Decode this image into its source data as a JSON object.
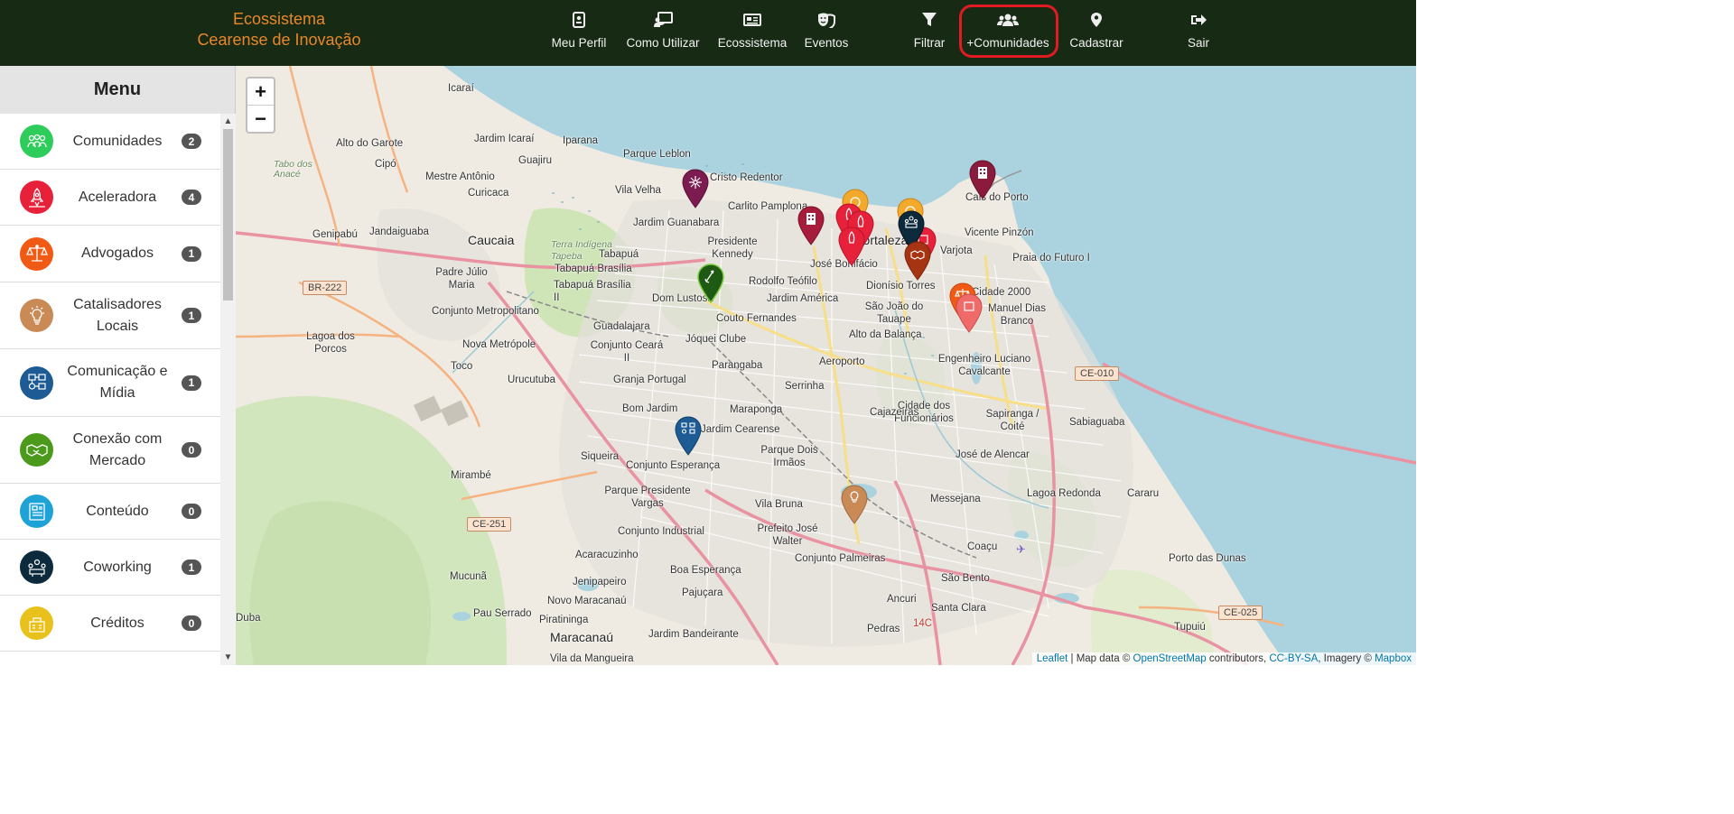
{
  "header": {
    "brand_line1": "Ecossistema",
    "brand_line2": "Cearense de Inovação",
    "nav": [
      {
        "label": "Meu Perfil",
        "icon": "id-badge-icon"
      },
      {
        "label": "Como Utilizar",
        "icon": "chalkboard-teacher-icon"
      },
      {
        "label": "Ecossistema",
        "icon": "newspaper-icon"
      },
      {
        "label": "Eventos",
        "icon": "masks-theater-icon"
      },
      {
        "label": "Filtrar",
        "icon": "filter-icon"
      },
      {
        "label": "+Comunidades",
        "icon": "users-icon"
      },
      {
        "label": "Cadastrar",
        "icon": "map-marker-icon"
      },
      {
        "label": "Sair",
        "icon": "sign-out-icon"
      }
    ]
  },
  "sidebar": {
    "title": "Menu",
    "items": [
      {
        "label": "Comunidades",
        "count": "2",
        "color": "#2ecc5a",
        "icon": "community-icon"
      },
      {
        "label": "Aceleradora",
        "count": "4",
        "color": "#e8213a",
        "icon": "rocket-icon"
      },
      {
        "label": "Advogados",
        "count": "1",
        "color": "#f05a14",
        "icon": "scales-icon"
      },
      {
        "label": "Catalisadores Locais",
        "count": "1",
        "color": "#c98a56",
        "icon": "lightbulb-icon"
      },
      {
        "label": "Comunicação e Mídia",
        "count": "1",
        "color": "#1d5b94",
        "icon": "media-icon"
      },
      {
        "label": "Conexão com Mercado",
        "count": "0",
        "color": "#4b9a1c",
        "icon": "handshake-icon"
      },
      {
        "label": "Conteúdo",
        "count": "0",
        "color": "#1fa3d6",
        "icon": "content-icon"
      },
      {
        "label": "Coworking",
        "count": "1",
        "color": "#0d2a3d",
        "icon": "coworking-icon"
      },
      {
        "label": "Créditos",
        "count": "0",
        "color": "#e8c11c",
        "icon": "credits-icon"
      }
    ]
  },
  "map": {
    "zoom_in": "+",
    "zoom_out": "−",
    "attribution": {
      "leaflet": "Leaflet",
      "sep1": " | Map data © ",
      "osm": "OpenStreetMap",
      "mid": " contributors, ",
      "ccbysa": "CC-BY-SA",
      "imagery": ", Imagery © ",
      "mapbox": "Mapbox"
    },
    "places": [
      "Icaraí",
      "Alto do Garote",
      "Tabo dos Anacé",
      "Cipó",
      "Jardim Icaraí",
      "Iparana",
      "Guajiru",
      "Parque Leblon",
      "Cristo Redentor",
      "Mestre Antônio",
      "Vila Velha",
      "Curicaca",
      "Carlito Pamplona",
      "Genipabú",
      "Jandaiguaba",
      "Caucaia",
      "Terra Indígena Tapeba",
      "Jardim Guanabara",
      "Presidente Kennedy",
      "Tabapuá",
      "Padre Júlio Maria",
      "Tabapuá Brasília",
      "Tabapuá Brasília II",
      "Rodolfo Teófilo",
      "Dom Lustosa",
      "Jardim América",
      "José Bonifácio",
      "Dionísio Torres",
      "Fortaleza",
      "Varjota",
      "Vicente Pinzón",
      "Praia do Futuro I",
      "Cais do Porto",
      "Cidade 2000",
      "Manuel Dias Branco",
      "São João do Tauape",
      "Conjunto Metropolitano",
      "Guadalajara",
      "Couto Fernandes",
      "Lagoa dos Porcos",
      "Nova Metrópole",
      "Conjunto Ceará II",
      "Jóquei Clube",
      "Alto da Balança",
      "Toco",
      "Parangaba",
      "Aeroporto",
      "Engenheiro Luciano Cavalcante",
      "Urucutuba",
      "Granja Portugal",
      "Serrinha",
      "Bom Jardim",
      "Maraponga",
      "Cidade dos Funcionários",
      "Sapiranga / Coité",
      "Sabiaguaba",
      "Jardim Cearense",
      "Cajazeiras",
      "Parque Dois Irmãos",
      "José de Alencar",
      "Siqueira",
      "Conjunto Esperança",
      "Mirambé",
      "Parque Presidente Vargas",
      "Vila Bruna",
      "Messejana",
      "Lagoa Redonda",
      "Cararu",
      "Prefeito José Walter",
      "Conjunto Industrial",
      "Coaçu",
      "Acaracuzinho",
      "Conjunto Palmeiras",
      "Mucunã",
      "Boa Esperança",
      "Jenipapeiro",
      "Pajuçara",
      "São Bento",
      "Porto das Dunas",
      "Novo Maracanaú",
      "Ancuri",
      "Santa Clara",
      "Pau Serrado",
      "Piratininga",
      "Pedras",
      "Maracanaú",
      "Jardim Bandeirante",
      "Tupuiú",
      "Vila da Mangueira",
      "Duba"
    ],
    "roads": [
      "BR-222",
      "CE-010",
      "CE-251",
      "CE-025",
      "14C"
    ],
    "markers": [
      {
        "category": "comunicacao",
        "color": "#7b1b4f",
        "icon": "network-icon"
      },
      {
        "category": "aceleradora",
        "color": "#a71b3b",
        "icon": "building-icon"
      },
      {
        "category": "aceleradora",
        "color": "#e8213a",
        "icon": "rocket-icon"
      },
      {
        "category": "coworking",
        "color": "#0d2a3d",
        "icon": "coworking-icon"
      },
      {
        "category": "comunidades",
        "color": "#1f5a14",
        "icon": "rocket-icon"
      },
      {
        "category": "comunicacao",
        "color": "#1d5b94",
        "icon": "media-icon"
      },
      {
        "category": "catalisadores",
        "color": "#c98a56",
        "icon": "lightbulb-icon"
      },
      {
        "category": "advogados",
        "color": "#f05a14",
        "icon": "scales-icon"
      },
      {
        "category": "cais",
        "color": "#8c1a3c",
        "icon": "building-icon"
      }
    ]
  }
}
